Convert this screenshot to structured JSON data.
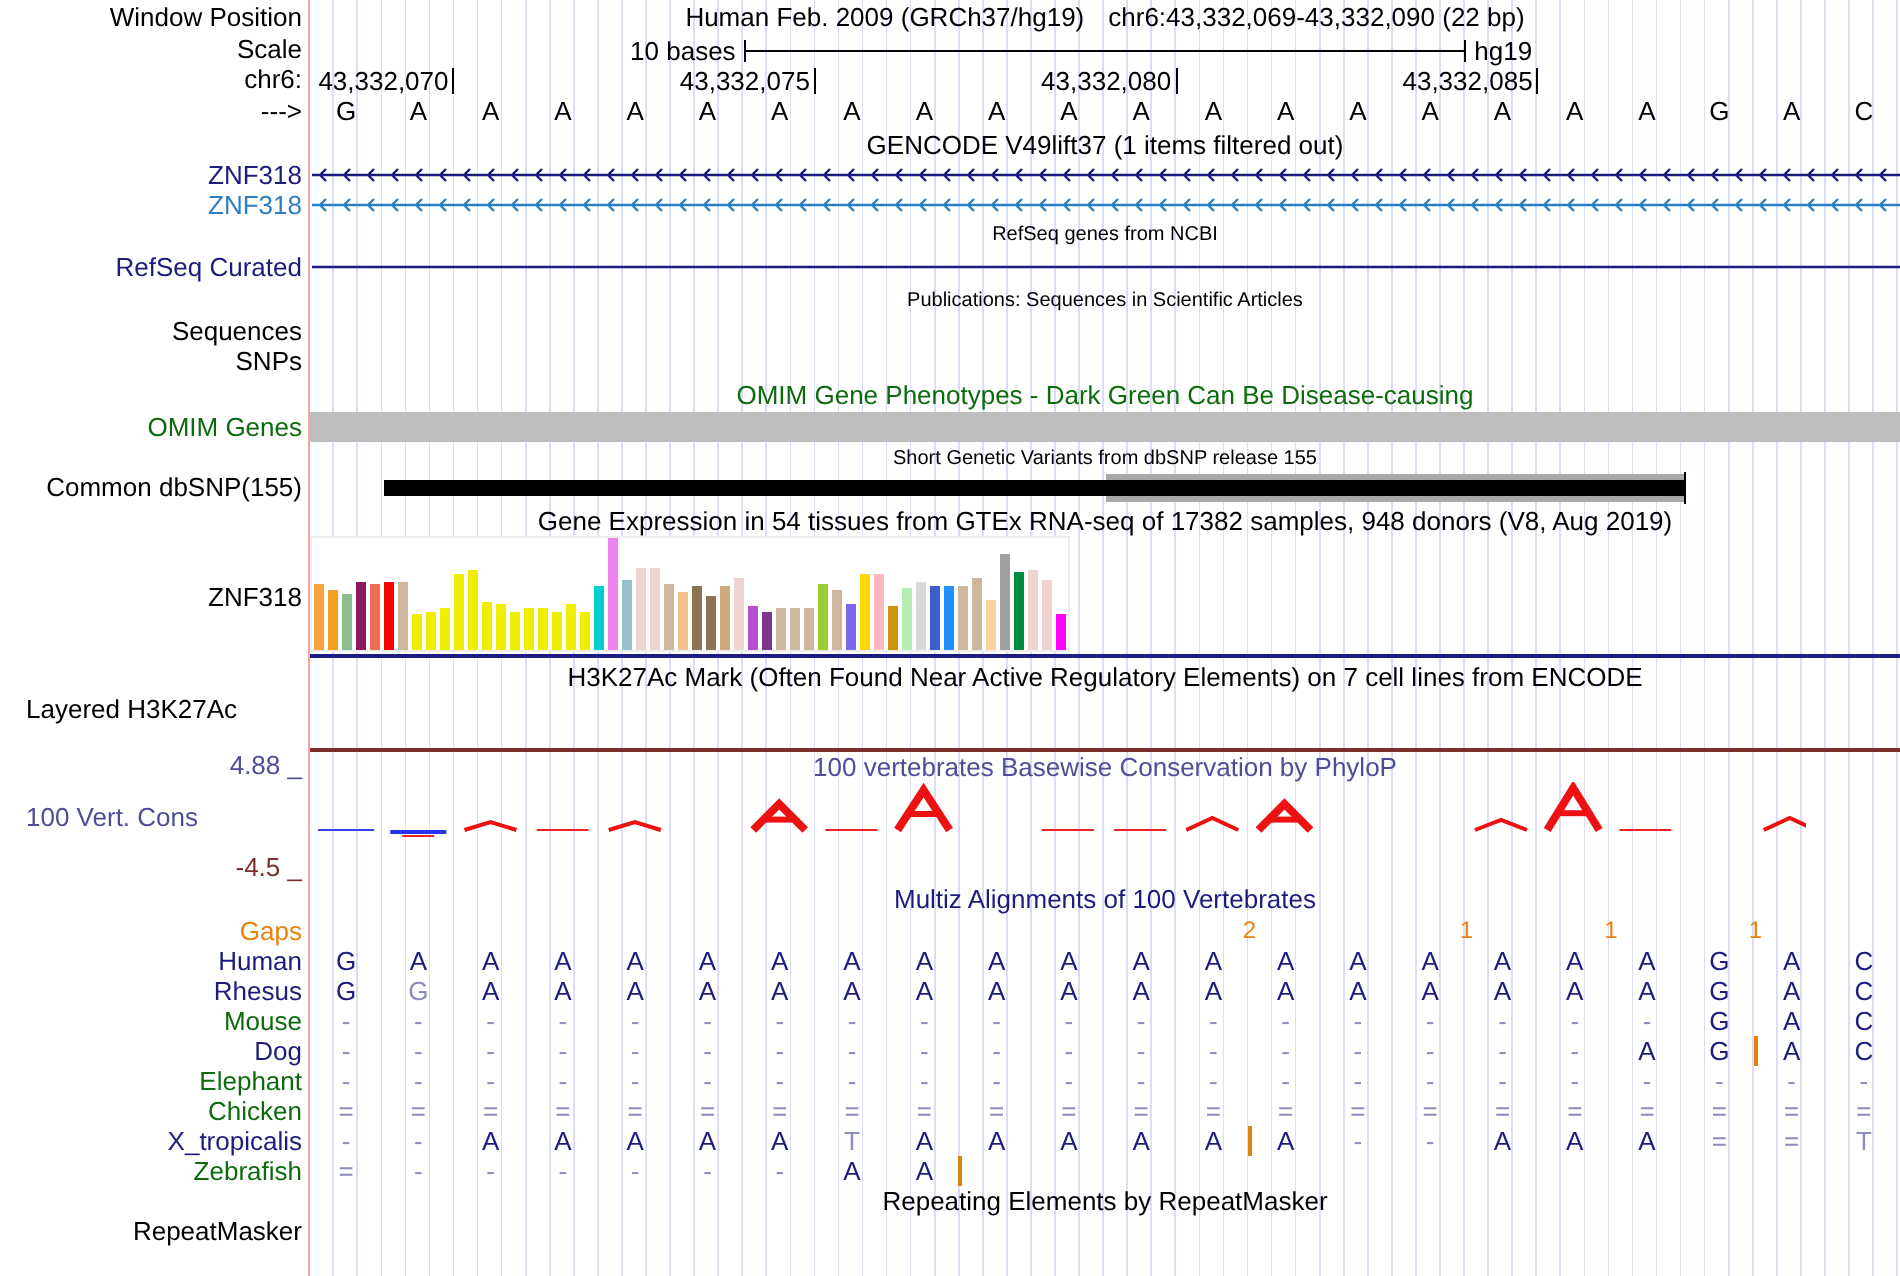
{
  "header": {
    "label": "Window Position",
    "assembly": "Human Feb. 2009 (GRCh37/hg19)",
    "position": "chr6:43,332,069-43,332,090 (22 bp)"
  },
  "scale": {
    "label": "Scale",
    "text": "10 bases",
    "db": "hg19"
  },
  "coordinates": {
    "label": "chr6:"
  },
  "sequence": {
    "label": "--->",
    "columns": [
      {
        "base": "G"
      },
      {
        "base": "A",
        "tick": "43,332,070"
      },
      {
        "base": "A"
      },
      {
        "base": "A"
      },
      {
        "base": "A"
      },
      {
        "base": "A"
      },
      {
        "base": "A",
        "tick": "43,332,075"
      },
      {
        "base": "A"
      },
      {
        "base": "A"
      },
      {
        "base": "A"
      },
      {
        "base": "A"
      },
      {
        "base": "A",
        "tick": "43,332,080"
      },
      {
        "base": "A",
        "gap": "2"
      },
      {
        "base": "A"
      },
      {
        "base": "A"
      },
      {
        "base": "A",
        "gap": "1"
      },
      {
        "base": "A",
        "tick": "43,332,085"
      },
      {
        "base": "A",
        "gap": "1"
      },
      {
        "base": "A"
      },
      {
        "base": "G",
        "gap": "1"
      },
      {
        "base": "A"
      },
      {
        "base": "C"
      }
    ]
  },
  "gencode": {
    "title": "GENCODE V49lift37 (1 items filtered out)",
    "genes": [
      {
        "name": "ZNF318",
        "color": "#1c1c7e"
      },
      {
        "name": "ZNF318",
        "color": "#2f7ec1"
      }
    ]
  },
  "refseq": {
    "title": "RefSeq genes from NCBI",
    "label": "RefSeq Curated"
  },
  "publications": {
    "title": "Publications: Sequences in Scientific Articles",
    "label": "Sequences"
  },
  "snps": {
    "label": "SNPs"
  },
  "omim": {
    "title": "OMIM Gene Phenotypes - Dark Green Can Be Disease-causing",
    "label": "OMIM Genes"
  },
  "dbsnp": {
    "title": "Short Genetic Variants from dbSNP release 155",
    "label": "Common dbSNP(155)"
  },
  "gtex": {
    "title": "Gene Expression in 54 tissues from GTEx RNA-seq of 17382 samples, 948 donors (V8, Aug 2019)",
    "label": "ZNF318"
  },
  "h3k27ac": {
    "title": "H3K27Ac Mark (Often Found Near Active Regulatory Elements) on 7 cell lines from ENCODE",
    "label": "Layered H3K27Ac"
  },
  "phylop": {
    "title": "100 vertebrates Basewise Conservation by PhyloP",
    "label": "100 Vert. Cons",
    "max": "4.88 _",
    "min": "-4.5 _"
  },
  "multiz": {
    "title": "Multiz Alignments of 100 Vertebrates",
    "gaps_label": "Gaps",
    "species": [
      {
        "name": "Human",
        "color": "#1c1c7e",
        "bases": [
          "G",
          "A",
          "A",
          "A",
          "A",
          "A",
          "A",
          "A",
          "A",
          "A",
          "A",
          "A",
          "A",
          "A",
          "A",
          "A",
          "A",
          "A",
          "A",
          "G",
          "A",
          "C"
        ],
        "faded": [
          false,
          false,
          false,
          false,
          false,
          false,
          false,
          false,
          false,
          false,
          false,
          false,
          false,
          false,
          false,
          false,
          false,
          false,
          false,
          false,
          false,
          false
        ],
        "insertion_after": [
          false,
          false,
          false,
          false,
          false,
          false,
          false,
          false,
          false,
          false,
          false,
          false,
          false,
          false,
          false,
          false,
          false,
          false,
          false,
          false,
          false,
          false
        ]
      },
      {
        "name": "Rhesus",
        "color": "#1c1c7e",
        "bases": [
          "G",
          "G",
          "A",
          "A",
          "A",
          "A",
          "A",
          "A",
          "A",
          "A",
          "A",
          "A",
          "A",
          "A",
          "A",
          "A",
          "A",
          "A",
          "A",
          "G",
          "A",
          "C"
        ],
        "faded": [
          false,
          true,
          false,
          false,
          false,
          false,
          false,
          false,
          false,
          false,
          false,
          false,
          false,
          false,
          false,
          false,
          false,
          false,
          false,
          false,
          false,
          false
        ],
        "insertion_after": [
          false,
          false,
          false,
          false,
          false,
          false,
          false,
          false,
          false,
          false,
          false,
          false,
          false,
          false,
          false,
          false,
          false,
          false,
          false,
          false,
          false,
          false
        ]
      },
      {
        "name": "Mouse",
        "color": "#0d6b0d",
        "bases": [
          "-",
          "-",
          "-",
          "-",
          "-",
          "-",
          "-",
          "-",
          "-",
          "-",
          "-",
          "-",
          "-",
          "-",
          "-",
          "-",
          "-",
          "-",
          "-",
          "G",
          "A",
          "C"
        ],
        "faded": [
          true,
          true,
          true,
          true,
          true,
          true,
          true,
          true,
          true,
          true,
          true,
          true,
          true,
          true,
          true,
          true,
          true,
          true,
          true,
          false,
          false,
          false
        ],
        "insertion_after": [
          false,
          false,
          false,
          false,
          false,
          false,
          false,
          false,
          false,
          false,
          false,
          false,
          false,
          false,
          false,
          false,
          false,
          false,
          false,
          false,
          false,
          false
        ]
      },
      {
        "name": "Dog",
        "color": "#1c1c7e",
        "bases": [
          "-",
          "-",
          "-",
          "-",
          "-",
          "-",
          "-",
          "-",
          "-",
          "-",
          "-",
          "-",
          "-",
          "-",
          "-",
          "-",
          "-",
          "-",
          "A",
          "G",
          "A",
          "C"
        ],
        "faded": [
          true,
          true,
          true,
          true,
          true,
          true,
          true,
          true,
          true,
          true,
          true,
          true,
          true,
          true,
          true,
          true,
          true,
          true,
          false,
          false,
          false,
          false
        ],
        "insertion_after": [
          false,
          false,
          false,
          false,
          false,
          false,
          false,
          false,
          false,
          false,
          false,
          false,
          false,
          false,
          false,
          false,
          false,
          false,
          false,
          true,
          false,
          false
        ]
      },
      {
        "name": "Elephant",
        "color": "#0d6b0d",
        "bases": [
          "-",
          "-",
          "-",
          "-",
          "-",
          "-",
          "-",
          "-",
          "-",
          "-",
          "-",
          "-",
          "-",
          "-",
          "-",
          "-",
          "-",
          "-",
          "-",
          "-",
          "-",
          "-"
        ],
        "faded": [
          true,
          true,
          true,
          true,
          true,
          true,
          true,
          true,
          true,
          true,
          true,
          true,
          true,
          true,
          true,
          true,
          true,
          true,
          true,
          true,
          true,
          true
        ],
        "insertion_after": [
          false,
          false,
          false,
          false,
          false,
          false,
          false,
          false,
          false,
          false,
          false,
          false,
          false,
          false,
          false,
          false,
          false,
          false,
          false,
          false,
          false,
          false
        ]
      },
      {
        "name": "Chicken",
        "color": "#0d6b0d",
        "bases": [
          "=",
          "=",
          "=",
          "=",
          "=",
          "=",
          "=",
          "=",
          "=",
          "=",
          "=",
          "=",
          "=",
          "=",
          "=",
          "=",
          "=",
          "=",
          "=",
          "=",
          "=",
          "="
        ],
        "faded": [
          true,
          true,
          true,
          true,
          true,
          true,
          true,
          true,
          true,
          true,
          true,
          true,
          true,
          true,
          true,
          true,
          true,
          true,
          true,
          true,
          true,
          true
        ],
        "insertion_after": [
          false,
          false,
          false,
          false,
          false,
          false,
          false,
          false,
          false,
          false,
          false,
          false,
          false,
          false,
          false,
          false,
          false,
          false,
          false,
          false,
          false,
          false
        ]
      },
      {
        "name": "X_tropicalis",
        "color": "#1c1c7e",
        "bases": [
          "-",
          "-",
          "A",
          "A",
          "A",
          "A",
          "A",
          "T",
          "A",
          "A",
          "A",
          "A",
          "A",
          "A",
          "-",
          "-",
          "A",
          "A",
          "A",
          "=",
          "=",
          "T"
        ],
        "faded": [
          true,
          true,
          false,
          false,
          false,
          false,
          false,
          true,
          false,
          false,
          false,
          false,
          false,
          false,
          true,
          true,
          false,
          false,
          false,
          true,
          true,
          true
        ],
        "insertion_after": [
          false,
          false,
          false,
          false,
          false,
          false,
          false,
          false,
          false,
          false,
          false,
          false,
          true,
          false,
          false,
          false,
          false,
          false,
          false,
          false,
          false,
          false
        ]
      },
      {
        "name": "Zebrafish",
        "color": "#0d6b0d",
        "bases": [
          "=",
          "-",
          "-",
          "-",
          "-",
          "-",
          "-",
          "A",
          "A"
        ],
        "faded": [
          true,
          true,
          true,
          true,
          true,
          true,
          true,
          false,
          false
        ],
        "insertion_after": [
          false,
          false,
          false,
          false,
          false,
          false,
          false,
          false,
          true
        ]
      }
    ]
  },
  "repeatmasker": {
    "title": "Repeating Elements by RepeatMasker",
    "label": "RepeatMasker"
  }
}
